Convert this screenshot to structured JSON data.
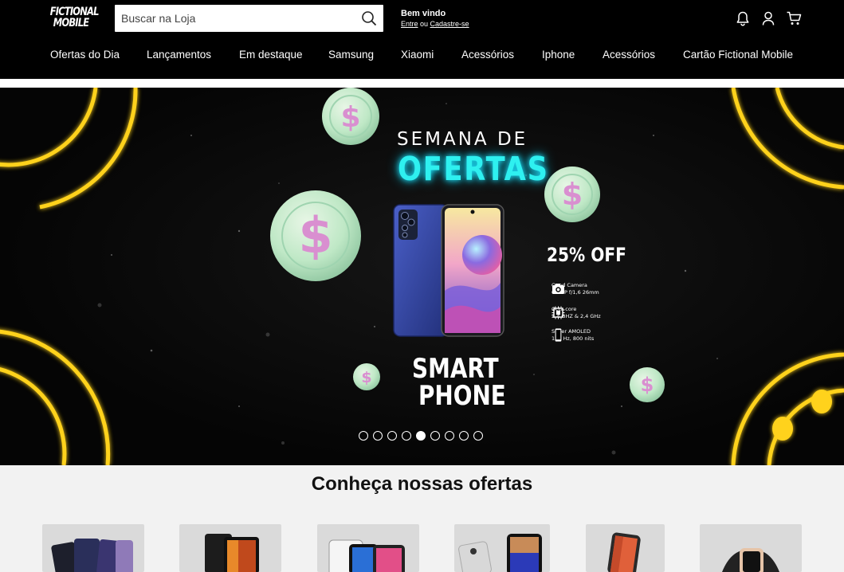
{
  "header": {
    "logo_line1": "FICTIONAL",
    "logo_line2": "MOBILE",
    "search_placeholder": "Buscar na Loja",
    "welcome_title": "Bem vindo",
    "login_link": "Entre",
    "welcome_separator": " ou ",
    "signup_link": "Cadastre-se",
    "icons": [
      "bell-icon",
      "user-icon",
      "cart-icon"
    ]
  },
  "nav": {
    "items": [
      {
        "label": "Ofertas do Dia"
      },
      {
        "label": "Lançamentos"
      },
      {
        "label": "Em destaque"
      },
      {
        "label": "Samsung"
      },
      {
        "label": "Xiaomi"
      },
      {
        "label": "Acessórios"
      },
      {
        "label": "Iphone"
      },
      {
        "label": "Acessórios"
      },
      {
        "label": "Cartão Fictional Mobile"
      }
    ]
  },
  "hero": {
    "line1": "SEMANA DE",
    "line2": "OFERTAS",
    "discount": "25% OFF",
    "product_line1": "SMART",
    "product_line2": "PHONE",
    "specs": [
      {
        "icon": "camera-icon",
        "line1": "Quad Camera",
        "line2": "64 MP f/1,6 26mm"
      },
      {
        "icon": "chip-icon",
        "line1": "Octa core",
        "line2": "2,4 GHZ & 2,4 GHz"
      },
      {
        "icon": "phone-screen-icon",
        "line1": "Super AMOLED",
        "line2": "120 Hz, 800 nits"
      }
    ],
    "slide_count": 9,
    "active_slide": 5
  },
  "offers": {
    "title": "Conheça nossas ofertas"
  },
  "colors": {
    "background": "#000000",
    "accent_cyan": "#2ef0f0",
    "neon_yellow": "#ffd21a",
    "coin_green": "#bfe8c6",
    "coin_pink": "#d98fd0",
    "page": "#f2f2f2"
  }
}
